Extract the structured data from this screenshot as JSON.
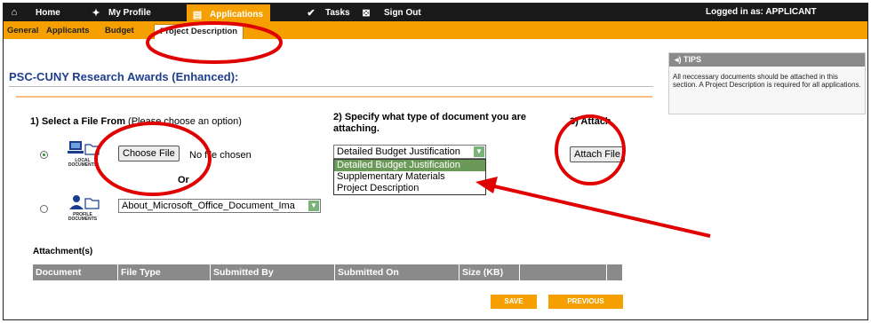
{
  "topnav": {
    "home": "Home",
    "profile": "My Profile",
    "applications": "Applications",
    "tasks": "Tasks",
    "signout": "Sign Out",
    "logged_in": "Logged in as: APPLICANT"
  },
  "subnav": {
    "general": "General",
    "applicants": "Applicants",
    "budget": "Budget",
    "project_description": "Project Description"
  },
  "page_title": "PSC-CUNY Research Awards (Enhanced):",
  "tips": {
    "header": "TIPS",
    "body": "All neccessary documents should be attached in this section. A Project Description is required for all applications."
  },
  "form": {
    "step1_label": "1) Select a File From",
    "step1_hint": "(Please choose an option)",
    "step2_label": "2) Specify what type of document you are attaching.",
    "step3_label": "3) Attach",
    "local_docs_caption": "LOCAL DOCUMENTS",
    "profile_docs_caption": "PROFILE DOCUMENTS",
    "choose_file_button": "Choose File",
    "no_file_text": "No file chosen",
    "or_text": "Or",
    "profile_file_value": "About_Microsoft_Office_Document_Ima",
    "doc_type_value": "Detailed Budget Justification",
    "doc_type_options": [
      "Detailed Budget Justification",
      "Supplementary Materials",
      "Project Description"
    ],
    "attach_button": "Attach File"
  },
  "attachments": {
    "title": "Attachment(s)",
    "columns": [
      "Document",
      "File Type",
      "Submitted By",
      "Submitted On",
      "Size (KB)"
    ]
  },
  "buttons": {
    "save": "SAVE",
    "previous": "PREVIOUS"
  },
  "annotation_color": "#e00000"
}
